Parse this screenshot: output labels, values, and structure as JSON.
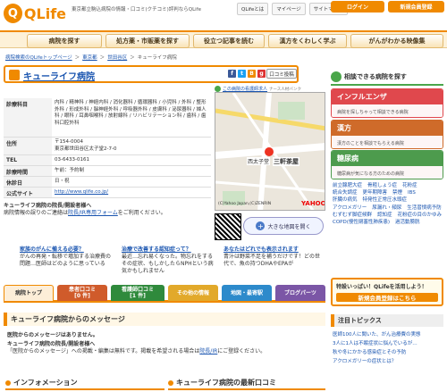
{
  "header": {
    "logo": "QLife",
    "tagline": "東京都立駒込病院の情報・口コミ(クチコミ)評判ならQLife",
    "links": [
      "QLifeとは",
      "マイページ",
      "サイトマップ"
    ],
    "login": "ログイン",
    "register": "新規会員登録"
  },
  "nav": [
    "病院を探す",
    "処方薬・市販薬を探す",
    "役立つ記事を読む",
    "漢方をくわしく学ぶ",
    "がんがわかる映像集"
  ],
  "breadcrumb": [
    "病院検索のQLifeトップページ",
    "東京都",
    "世田谷区",
    "キューライフ病院"
  ],
  "hospital": {
    "name": "キューライフ病院",
    "kuchikomi": "口コミ投稿",
    "departments_label": "診療科目",
    "departments": "内科 / 精神科 / 神経内科 / 消化器科 / 循環器科 / 小児科 / 外科 / 整形外科 / 形成外科 / 脳神経外科 / 呼吸器外科 / 皮膚科 / 泌尿器科 / 婦人科 / 眼科 / 耳鼻咽喉科 / 放射線科 / リハビリテーション科 / 歯科 / 歯科口腔外科",
    "address_label": "住所",
    "postal": "〒154-0004",
    "address": "東京都世田谷区太子堂2-7-0",
    "tel_label": "TEL",
    "tel": "03-6433-0161",
    "hours_label": "診療時間",
    "hours": "午前：予約制",
    "holiday_label": "休診日",
    "holiday": "日・祝",
    "site_label": "公式サイト",
    "site": "http://www.qlife.co.jp/"
  },
  "map": {
    "caption": "この病院の看護師求人",
    "nurse_badge": "ナース人材バンク",
    "station": "三軒茶屋",
    "place1": "西太子堂",
    "place2": "三軒茶屋",
    "copyright": "(C)Yahoo Japan,(C)ZENRIN",
    "provider": "YAHOO!",
    "big_map": "大きな地図を開く"
  },
  "notice": {
    "title": "キューライフ病院の院長/開設者様へ",
    "body": "病院情報の誤りのご連絡は",
    "link": "院長/IR専用フォーム",
    "body2": "をご利用ください。"
  },
  "ads": [
    {
      "title": "家族のがんに備える必要？",
      "body": "がんの再発・転移で増加する治療費の問題…医師はどのように思っている"
    },
    {
      "title": "治療で改善する認知症って？",
      "body": "最近…忘れ易くなった。物忘れをするその症状、もしかしたらNPHという病気かもしれません"
    },
    {
      "title": "あなたはどれでも表示されます",
      "body": "青汁は野菜不足を補うだけです！どの世代で、魚の持つDHAやEPAが"
    }
  ],
  "tabs": [
    {
      "label": "病院トップ",
      "sub": "",
      "color": "#fdeed8"
    },
    {
      "label": "患者口コミ",
      "sub": "[0 件]",
      "color": "#d05b2b"
    },
    {
      "label": "看護師口コミ",
      "sub": "[1 件]",
      "color": "#2f8a3c"
    },
    {
      "label": "その他の情報",
      "sub": "",
      "color": "#e2a92a"
    },
    {
      "label": "地図・最寄駅",
      "sub": "",
      "color": "#2d8acb"
    },
    {
      "label": "ブログパーツ",
      "sub": "",
      "color": "#7b56a6"
    }
  ],
  "message": {
    "heading": "キューライフ病院からのメッセージ",
    "none": "医院からのメッセージはありません。",
    "to_director": "キューライフ病院の院長/開設者様へ",
    "desc": "「医院からのメッセージ」への掲載・編集は無料です。掲載を希望される場合は",
    "desc_link": "院長/IR",
    "desc2": "にご登録ください。"
  },
  "info_heading": "インフォメーション",
  "latest_heading": "キューライフ病院の最新口コミ",
  "right": {
    "heading": "相談できる病院を探す",
    "cards": [
      {
        "title": "インフルエンザ",
        "sub": "病院を探しちゃって相談できる病院",
        "color": "#e0484d"
      },
      {
        "title": "漢方",
        "sub": "漢方のことを相談でもらえる病院",
        "color": "#cf6b2a"
      },
      {
        "title": "糖尿病",
        "sub": "糖尿病が気になる方のための病院",
        "color": "#4d9b4d"
      }
    ],
    "links": [
      "前立腺肥大症",
      "骨粗しょう症",
      "花粉症",
      "統合失調症",
      "更年期障害",
      "禁煙",
      "IBS",
      "肝臓の病気",
      "特発性正常圧水頭症",
      "アクロメガリー",
      "尿漏れ・頻尿",
      "生活習慣病予防",
      "むずむず脚症候群",
      "認知症",
      "花粉症の目のかゆみ",
      "COPD(慢性閉塞性肺疾患)",
      "過活動膀胱"
    ],
    "special": "特設いっぱい！QLifeを活用しよう！",
    "special_link": "新規会員登録はこちら",
    "topics_heading": "注目トピックス",
    "topics": [
      "医師100人に聞いた、がん治療費の実態",
      "3人に1人は不眠症状に悩んでいるが…",
      "秋や冬にかかる感染症とその予防",
      "アクロメガリーの症状とは？"
    ]
  }
}
